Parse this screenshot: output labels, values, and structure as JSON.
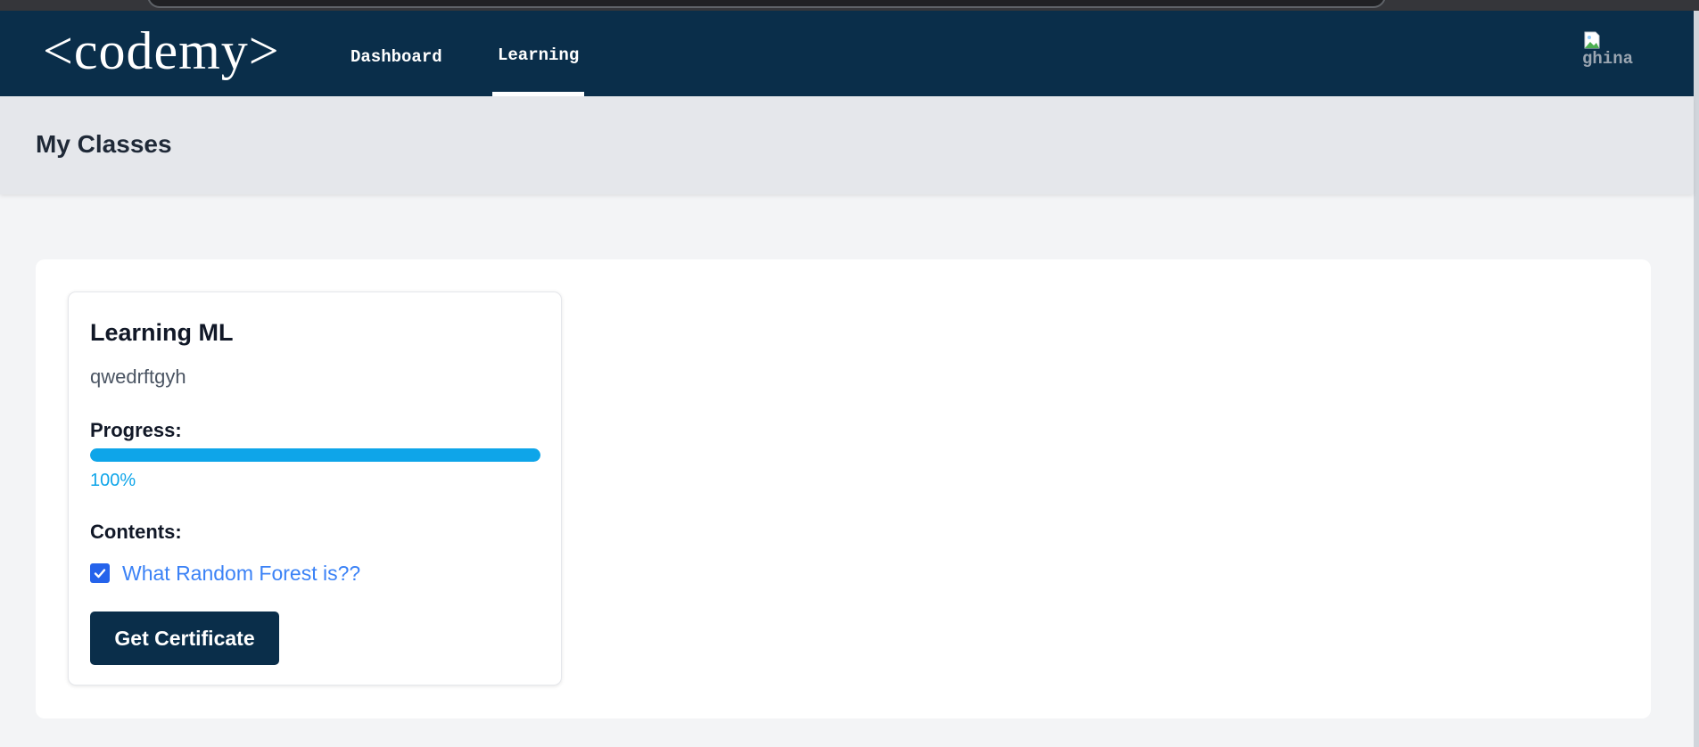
{
  "app": {
    "logo_text": "<codemy>"
  },
  "nav": {
    "items": [
      {
        "label": "Dashboard",
        "active": false
      },
      {
        "label": "Learning",
        "active": true
      }
    ],
    "user": {
      "name": "ghina",
      "avatar_icon": "broken-image-icon"
    }
  },
  "page": {
    "title": "My Classes"
  },
  "classes": [
    {
      "title": "Learning ML",
      "description": "qwedrftgyh",
      "progress_label": "Progress:",
      "progress_percent": 100,
      "progress_text": "100%",
      "contents_label": "Contents:",
      "contents": [
        {
          "label": "What Random Forest is??",
          "completed": true,
          "icon": "checkbox-checked-icon"
        }
      ],
      "certificate_button": "Get Certificate"
    }
  ],
  "colors": {
    "navbar": "#0a2e4a",
    "accent": "#0ea5e9",
    "checkbox": "#2563eb",
    "link": "#3b82f6",
    "page_bg": "#f3f4f6"
  }
}
